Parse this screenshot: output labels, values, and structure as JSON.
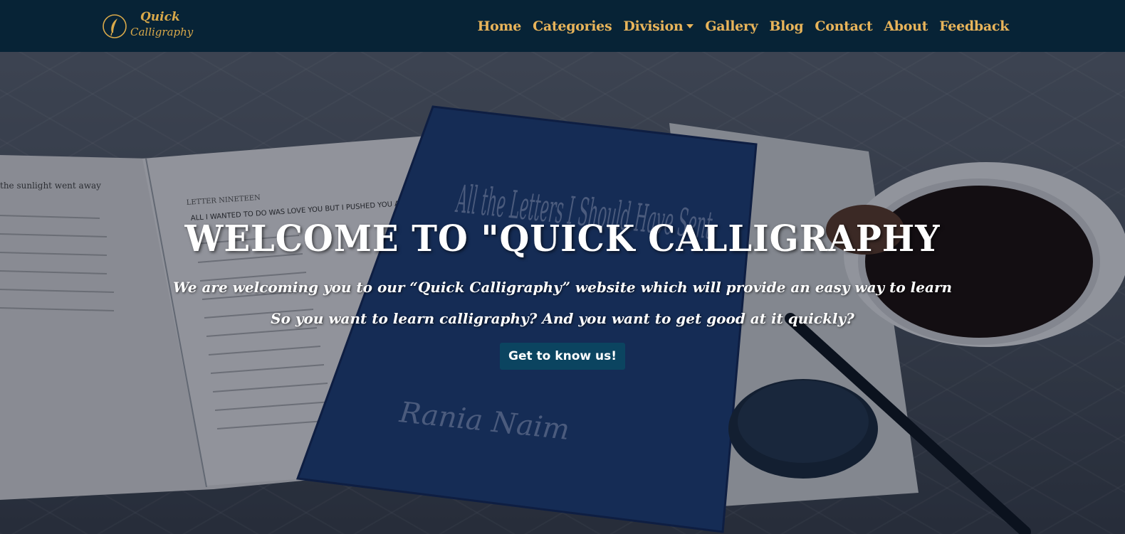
{
  "brand": {
    "line1": "Quick",
    "line2": "Calligraphy",
    "logo_icon": "quill-pen-emblem-icon"
  },
  "nav": {
    "items": [
      {
        "label": "Home"
      },
      {
        "label": "Categories"
      },
      {
        "label": "Division",
        "dropdown": true
      },
      {
        "label": "Gallery"
      },
      {
        "label": "Blog"
      },
      {
        "label": "Contact"
      },
      {
        "label": "About"
      },
      {
        "label": "Feedback"
      }
    ]
  },
  "hero": {
    "title": "WELCOME TO \"QUICK CALLIGRAPHY",
    "subtitle_line1": "We are welcoming you to our “Quick Calligraphy” website which will provide an easy way to learn",
    "subtitle_line2": "So you want to learn calligraphy? And you want to get good at it quickly?",
    "cta_label": "Get to know us!",
    "book_cover_text": "All the Letters I Should Have Sent",
    "book_author": "Rania Naim",
    "open_book_text": {
      "left_page_snippet": "the sunlight went away",
      "heading": "LETTER NINETEEN",
      "subheading": "ALL I WANTED TO DO WAS LOVE YOU BUT I PUSHED YOU AWAY INSTEAD"
    }
  },
  "colors": {
    "navbar_bg": "#072336",
    "nav_text": "#e8b45a",
    "cta_bg": "#0b4460",
    "hero_text": "#ffffff"
  }
}
